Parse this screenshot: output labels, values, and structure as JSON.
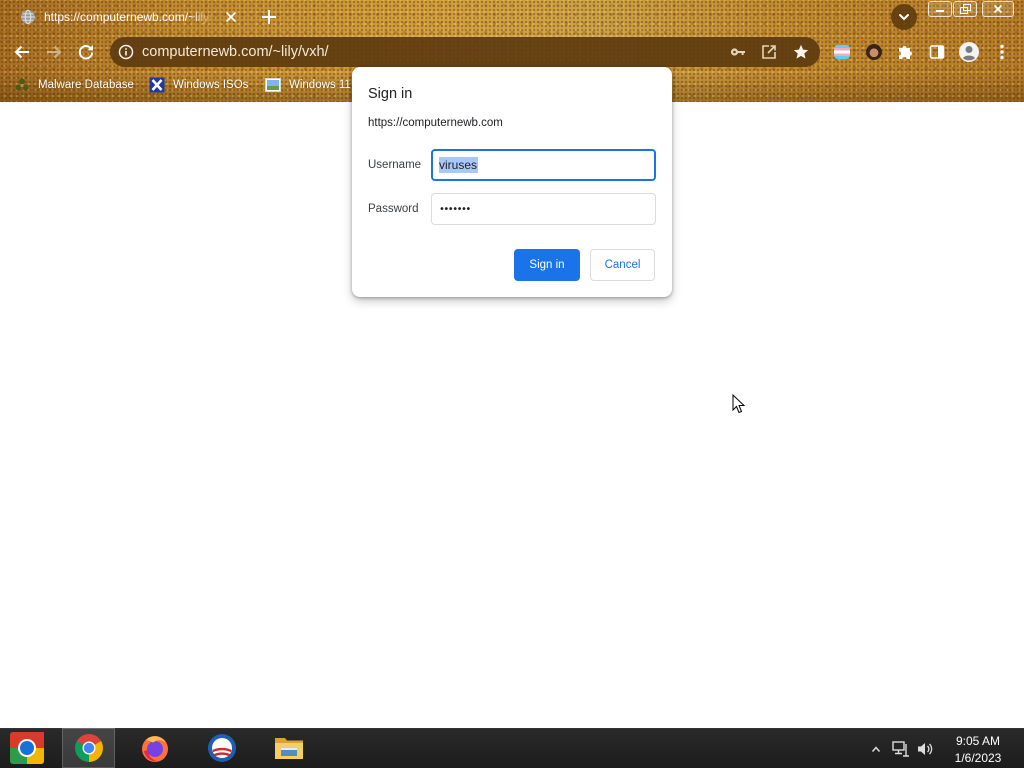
{
  "window": {
    "controls": {
      "minimize_icon": "minimize-icon",
      "restore_icon": "restore-icon",
      "close_icon": "close-icon"
    }
  },
  "tabstrip": {
    "tab": {
      "favicon": "globe-icon",
      "title": "https://computernewb.com/~lily/",
      "close_icon": "close-icon"
    },
    "new_tab_icon": "plus-icon",
    "tab_search_icon": "chevron-down-icon"
  },
  "toolbar": {
    "back_icon": "arrow-left-icon",
    "forward_icon": "arrow-right-icon",
    "forward_enabled": false,
    "reload_icon": "reload-icon",
    "site_info_icon": "info-icon",
    "url": "computernewb.com/~lily/vxh/",
    "omnibox_icons": [
      "key-icon",
      "share-icon",
      "star-icon"
    ],
    "extension_icons": [
      "pride-flag-icon",
      "avatar-icon",
      "puzzle-icon",
      "side-panel-icon",
      "profile-icon",
      "more-vertical-icon"
    ]
  },
  "bookmarks": [
    {
      "icon": "biohazard-icon",
      "label": "Malware Database"
    },
    {
      "icon": "x-logo-icon",
      "label": "Windows ISOs"
    },
    {
      "icon": "image-icon",
      "label": "Windows 11"
    }
  ],
  "dialog": {
    "title": "Sign in",
    "origin": "https://computernewb.com",
    "username_label": "Username",
    "username_value": "viruses",
    "username_selected": true,
    "password_label": "Password",
    "password_mask": "•••••••",
    "sign_in_label": "Sign in",
    "cancel_label": "Cancel"
  },
  "taskbar": {
    "start_icon": "start-orb-icon",
    "apps": [
      {
        "icon": "chrome-icon",
        "active": true
      },
      {
        "icon": "firefox-icon",
        "active": false
      },
      {
        "icon": "obama-logo-icon",
        "active": false
      },
      {
        "icon": "file-explorer-icon",
        "active": false
      }
    ],
    "tray_icons": [
      "chevron-up-icon",
      "network-icon",
      "volume-icon"
    ],
    "clock": {
      "time": "9:05 AM",
      "date": "1/6/2023"
    }
  },
  "colors": {
    "theme_gold": "#c48b2f",
    "theme_brown": "#6b4212",
    "omnibox_bg": "#5e3b10",
    "accent_blue": "#1a73e8",
    "selection_highlight": "#a8c7fa",
    "taskbar_bg": "#1c1c1c"
  }
}
